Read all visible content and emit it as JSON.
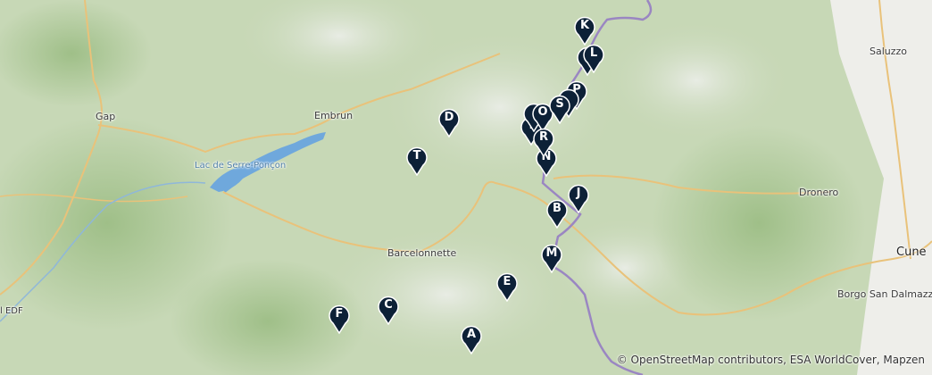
{
  "places": {
    "gap": "Gap",
    "embrun": "Embrun",
    "lake": "Lac de Serre-Ponçon",
    "barcelonnette": "Barcelonnette",
    "saluzzo": "Saluzzo",
    "dronero": "Dronero",
    "cuneo": "Cune",
    "borgo": "Borgo San Dalmazzo",
    "edf": "l EDF"
  },
  "markers": [
    "A",
    "B",
    "C",
    "D",
    "E",
    "F",
    "I",
    "J",
    "K",
    "L",
    "M",
    "N",
    "O",
    "P",
    "R",
    "S",
    "T"
  ],
  "attribution": "© OpenStreetMap contributors, ESA WorldCover, Mapzen",
  "colors": {
    "marker": "#0d2137",
    "border": "#9a86c2",
    "road": "#e9c27a",
    "water": "#6fa8dc"
  }
}
